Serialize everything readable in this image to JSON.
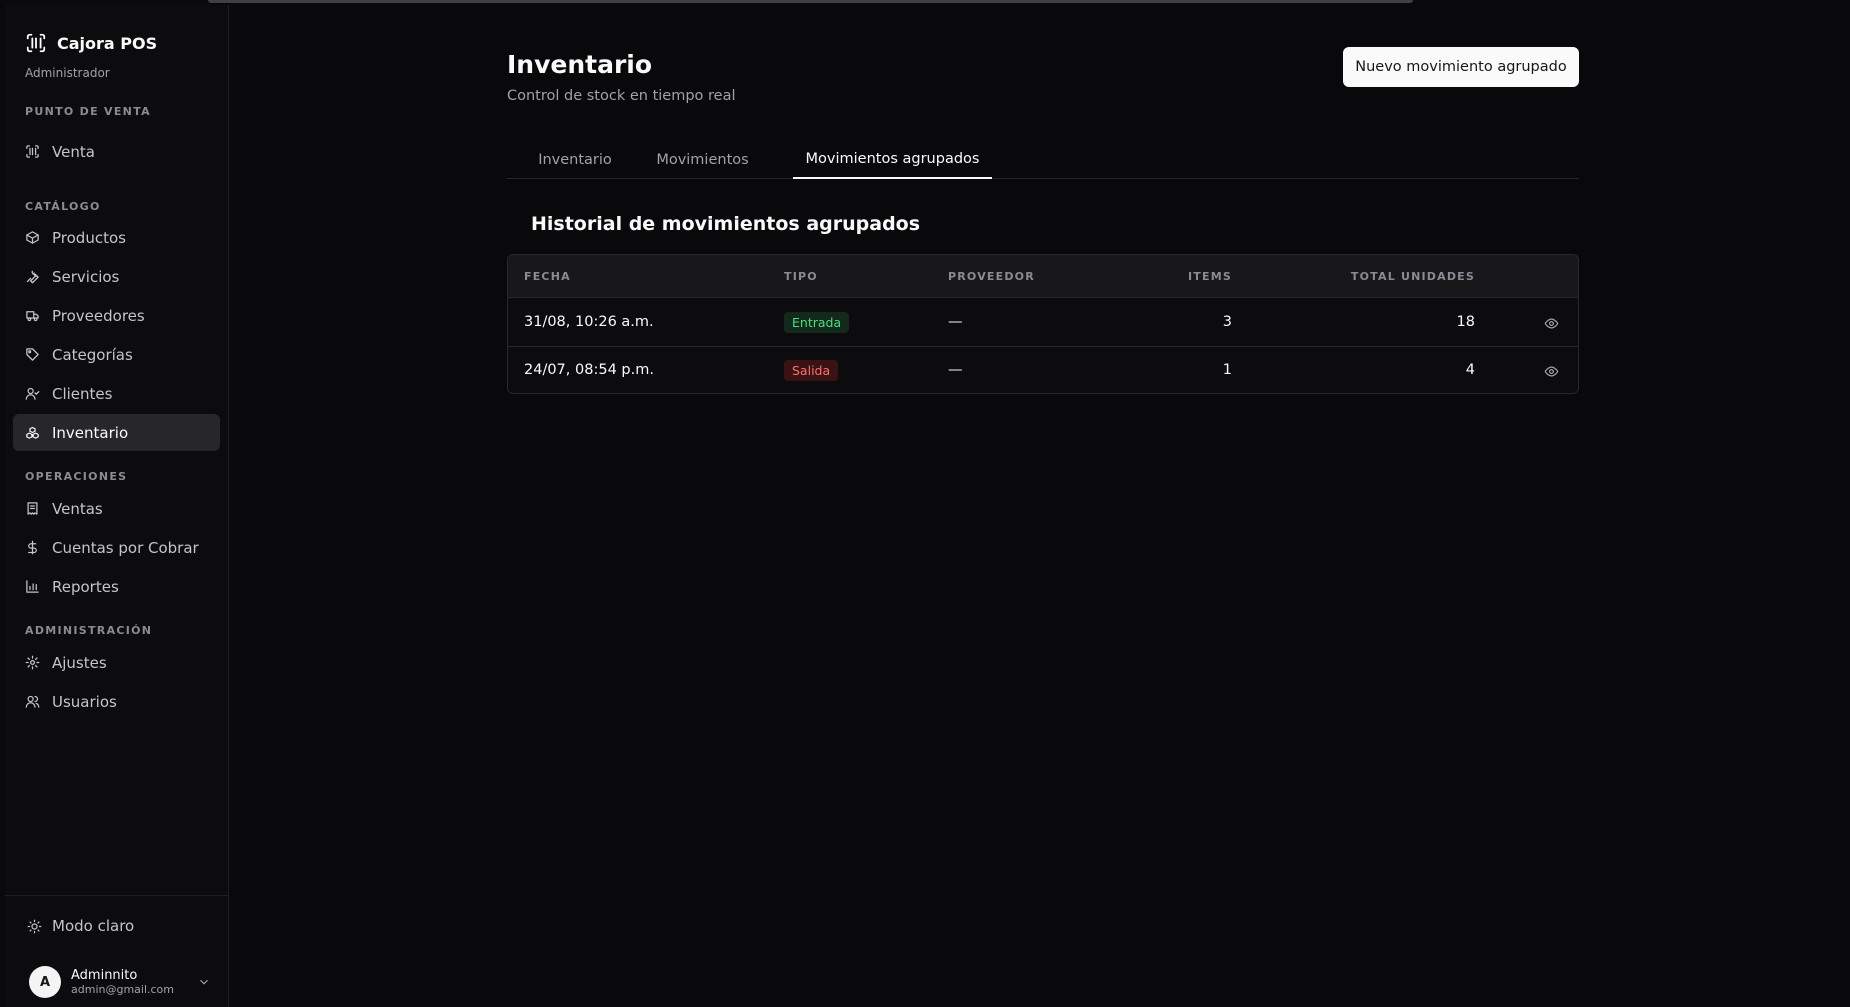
{
  "app": {
    "name": "Cajora POS",
    "role": "Administrador"
  },
  "sidebar": {
    "sections": [
      {
        "label": "PUNTO DE VENTA"
      },
      {
        "label": "CATÁLOGO"
      },
      {
        "label": "OPERACIONES"
      },
      {
        "label": "ADMINISTRACIÓN"
      }
    ],
    "items": [
      {
        "label": "Venta",
        "icon": "scan-barcode-icon"
      },
      {
        "label": "Productos",
        "icon": "package-icon"
      },
      {
        "label": "Servicios",
        "icon": "wrench-icon"
      },
      {
        "label": "Proveedores",
        "icon": "truck-icon"
      },
      {
        "label": "Categorías",
        "icon": "tag-icon"
      },
      {
        "label": "Clientes",
        "icon": "user-check-icon"
      },
      {
        "label": "Inventario",
        "icon": "boxes-icon",
        "active": true
      },
      {
        "label": "Ventas",
        "icon": "receipt-icon"
      },
      {
        "label": "Cuentas por Cobrar",
        "icon": "dollar-icon"
      },
      {
        "label": "Reportes",
        "icon": "bar-chart-icon"
      },
      {
        "label": "Ajustes",
        "icon": "gear-icon"
      },
      {
        "label": "Usuarios",
        "icon": "users-icon"
      }
    ],
    "theme_toggle": "Modo claro",
    "user": {
      "initial": "A",
      "name": "Adminnito",
      "email": "admin@gmail.com"
    }
  },
  "header": {
    "title": "Inventario",
    "subtitle": "Control de stock en tiempo real",
    "primary_button": "Nuevo movimiento agrupado"
  },
  "tabs": [
    {
      "label": "Inventario"
    },
    {
      "label": "Movimientos"
    },
    {
      "label": "Movimientos agrupados",
      "active": true
    }
  ],
  "section": {
    "title": "Historial de movimientos agrupados"
  },
  "table": {
    "columns": [
      "FECHA",
      "TIPO",
      "PROVEEDOR",
      "ITEMS",
      "TOTAL UNIDADES"
    ],
    "rows": [
      {
        "fecha": "31/08, 10:26 a.m.",
        "tipo": "Entrada",
        "proveedor": "—",
        "items": "3",
        "total": "18"
      },
      {
        "fecha": "24/07, 08:54 p.m.",
        "tipo": "Salida",
        "proveedor": "—",
        "items": "1",
        "total": "4"
      }
    ]
  },
  "colors": {
    "background": "#09090b",
    "accent": "#fafafa",
    "entrada": "#4ade80",
    "salida": "#f87171"
  }
}
